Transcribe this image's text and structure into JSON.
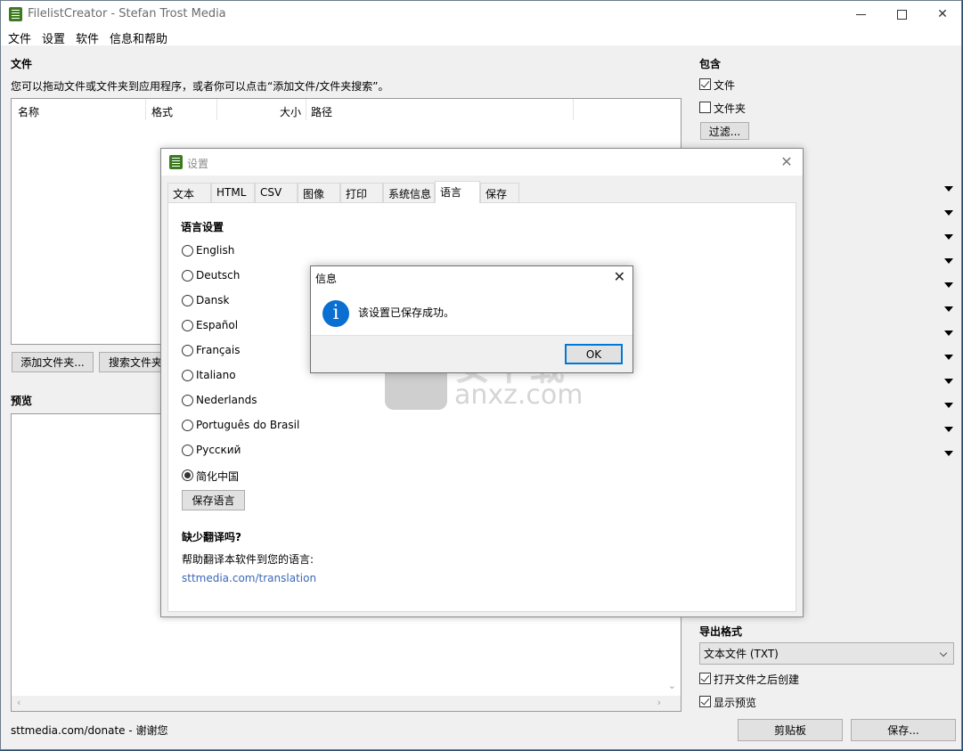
{
  "window": {
    "title": "FilelistCreator - Stefan Trost Media",
    "controls": {
      "minimize": "minimize",
      "maximize": "maximize",
      "close": "✕"
    }
  },
  "menubar": [
    "文件",
    "设置",
    "软件",
    "信息和帮助"
  ],
  "files_section": {
    "title": "文件",
    "hint": "您可以拖动文件或文件夹到应用程序，或者你可以点击“添加文件/文件夹搜索”。",
    "columns": [
      "名称",
      "格式",
      "大小",
      "路径"
    ],
    "rows": [],
    "buttons": {
      "add_folder": "添加文件夹...",
      "search_folder": "搜索文件夹"
    }
  },
  "preview_section": {
    "title": "预览"
  },
  "right_panel": {
    "include_title": "包含",
    "include_files": {
      "label": "文件",
      "checked": true
    },
    "include_folders": {
      "label": "文件夹",
      "checked": false
    },
    "filter_button": "过滤...",
    "dropdown_arrow_count": 12,
    "export_format_title": "导出格式",
    "export_format_value": "文本文件 (TXT)",
    "open_after_create": {
      "label": "打开文件之后创建",
      "checked": true
    },
    "show_preview": {
      "label": "显示预览",
      "checked": true
    },
    "clipboard_button": "剪贴板",
    "save_button": "保存..."
  },
  "footer": {
    "donate_text": "sttmedia.com/donate - 谢谢您"
  },
  "settings_dialog": {
    "title": "设置",
    "close": "✕",
    "tabs": [
      "文本",
      "HTML",
      "CSV",
      "图像",
      "打印",
      "系统信息",
      "语言",
      "保存"
    ],
    "active_tab": "语言",
    "language_settings_title": "语言设置",
    "languages": [
      {
        "label": "English",
        "selected": false
      },
      {
        "label": "Deutsch",
        "selected": false
      },
      {
        "label": "Dansk",
        "selected": false
      },
      {
        "label": "Español",
        "selected": false
      },
      {
        "label": "Français",
        "selected": false
      },
      {
        "label": "Italiano",
        "selected": false
      },
      {
        "label": "Nederlands",
        "selected": false
      },
      {
        "label": "Português do Brasil",
        "selected": false
      },
      {
        "label": "Русский",
        "selected": false
      },
      {
        "label": "简化中国",
        "selected": true
      }
    ],
    "save_language_button": "保存语言",
    "missing_translation_title": "缺少翻译吗?",
    "help_translate_text": "帮助翻译本软件到您的语言:",
    "translation_link": "sttmedia.com/translation"
  },
  "message_box": {
    "title": "信息",
    "close": "✕",
    "icon": "info-icon",
    "icon_glyph": "i",
    "message": "该设置已保存成功。",
    "ok_button": "OK"
  },
  "watermark": {
    "text_cn": "安下载",
    "text_url": "anxz.com"
  },
  "colors": {
    "accent_blue": "#0078d7",
    "info_icon": "#0a6fd0",
    "link": "#3c67b5",
    "app_icon_green": "#3d7a1e",
    "window_bg": "#f0f0f0"
  }
}
